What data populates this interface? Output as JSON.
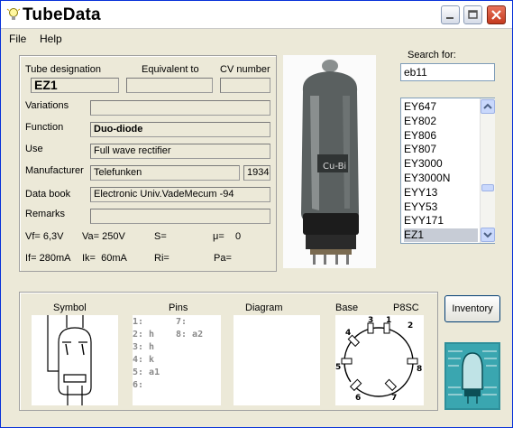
{
  "window": {
    "title": "TubeData"
  },
  "menu": [
    "File",
    "Help"
  ],
  "labels": {
    "tube_designation": "Tube designation",
    "equivalent_to": "Equivalent to",
    "cv_number": "CV number",
    "variations": "Variations",
    "function": "Function",
    "use": "Use",
    "manufacturer": "Manufacturer",
    "data_book": "Data book",
    "remarks": "Remarks"
  },
  "tube": {
    "designation": "EZ1",
    "equivalent": "",
    "cv_number": "",
    "variations": "",
    "function": "Duo-diode",
    "use": "Full wave rectifier",
    "manufacturer": "Telefunken",
    "year": "1934",
    "data_book": "Electronic Univ.VadeMecum -94",
    "remarks": ""
  },
  "stats": {
    "vf": "Vf= 6,3V",
    "va": "Va= 250V",
    "s": "S=",
    "mu": "μ=    0",
    "if": "If= 280mA",
    "ik": "Ik=  60mA",
    "ri": "Ri=",
    "pa": "Pa="
  },
  "search": {
    "label": "Search for:",
    "value": "eb11"
  },
  "tube_list": [
    "EY647",
    "EY802",
    "EY806",
    "EY807",
    "EY3000",
    "EY3000N",
    "EYY13",
    "EYY53",
    "EYY171",
    "EZ1"
  ],
  "tube_list_selected": "EZ1",
  "bottom": {
    "symbol_label": "Symbol",
    "pins_label": "Pins",
    "diagram_label": "Diagram",
    "base_label": "Base",
    "base_type": "P8SC",
    "pins_left": [
      "1:",
      "2: h",
      "3: h",
      "4: k",
      "5: a1",
      "6:"
    ],
    "pins_right": [
      "7:",
      "8: a2"
    ],
    "base_pin_numbers": [
      "1",
      "2",
      "3",
      "4",
      "5",
      "6",
      "7",
      "8"
    ]
  },
  "inventory_button": "Inventory",
  "photo_text": "Cu-Bi",
  "colors": {
    "window_bg": "#ece9d8",
    "selection": "#c7ccd6",
    "close_button": "#c4391e"
  }
}
